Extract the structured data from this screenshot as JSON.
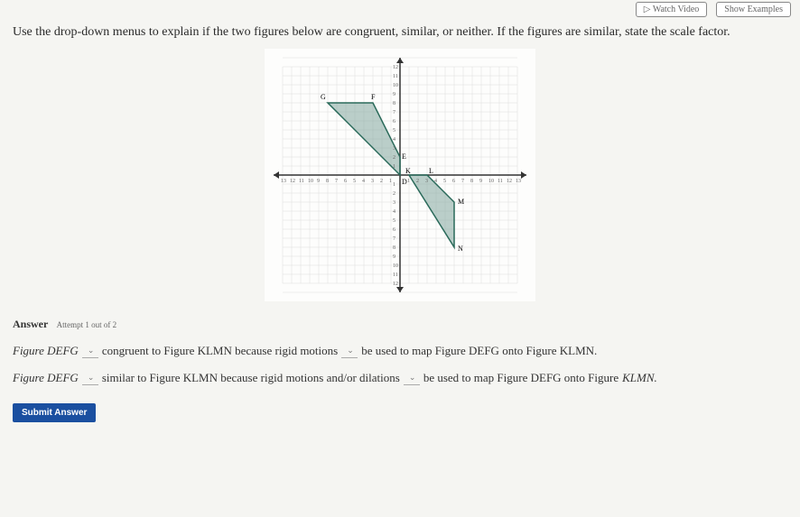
{
  "header": {
    "watch": "Watch Video",
    "show": "Show Examples"
  },
  "question": "Use the drop-down menus to explain if the two figures below are congruent, similar, or neither. If the figures are similar, state the scale factor.",
  "answer_label": "Answer",
  "attempt": "Attempt 1 out of 2",
  "s1": {
    "figDEFG": "Figure DEFG",
    "congruentTo": "congruent to Figure KLMN because rigid motions",
    "mapTail": "be used to map Figure DEFG onto Figure KLMN."
  },
  "s2": {
    "figDEFG": "Figure DEFG",
    "similarTo": "similar to Figure KLMN because rigid motions and/or dilations",
    "mapTail": "be used to map Figure DEFG onto Figure",
    "klmn": "KLMN."
  },
  "submit": "Submit Answer",
  "chart_data": {
    "type": "scatter",
    "title": "",
    "xlabel": "",
    "ylabel": "",
    "xlim": [
      -13,
      13
    ],
    "ylim": [
      -13,
      13
    ],
    "grid": true,
    "series": [
      {
        "name": "DEFG",
        "shape": "polygon",
        "points": [
          {
            "label": "D",
            "x": 0,
            "y": 0
          },
          {
            "label": "E",
            "x": 0,
            "y": 2
          },
          {
            "label": "F",
            "x": -3,
            "y": 8
          },
          {
            "label": "G",
            "x": -8,
            "y": 8
          }
        ]
      },
      {
        "name": "KLMN",
        "shape": "polygon",
        "points": [
          {
            "label": "K",
            "x": 1,
            "y": 0
          },
          {
            "label": "L",
            "x": 3,
            "y": 0
          },
          {
            "label": "M",
            "x": 6,
            "y": -3
          },
          {
            "label": "N",
            "x": 6,
            "y": -8
          }
        ]
      }
    ],
    "x_ticks": [
      -13,
      -12,
      -11,
      -10,
      -9,
      -8,
      -7,
      -6,
      -5,
      -4,
      -3,
      -2,
      -1,
      1,
      2,
      3,
      4,
      5,
      6,
      7,
      8,
      9,
      10,
      11,
      12,
      13
    ],
    "y_ticks": [
      -12,
      -11,
      -10,
      -9,
      -8,
      -7,
      -6,
      -5,
      -4,
      -3,
      -2,
      -1,
      1,
      2,
      3,
      4,
      5,
      6,
      7,
      8,
      9,
      10,
      11,
      12
    ]
  }
}
